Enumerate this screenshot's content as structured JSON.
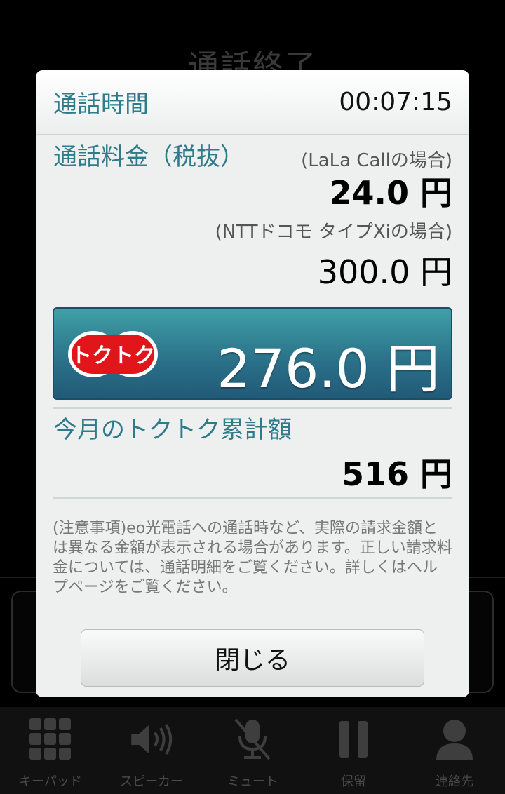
{
  "background": {
    "title": "通話終了",
    "toolbar": [
      {
        "label": "キーパッド",
        "icon": "keypad-icon"
      },
      {
        "label": "スピーカー",
        "icon": "speaker-icon"
      },
      {
        "label": "ミュート",
        "icon": "mute-icon"
      },
      {
        "label": "保留",
        "icon": "hold-icon"
      },
      {
        "label": "連絡先",
        "icon": "contacts-icon"
      }
    ]
  },
  "dialog": {
    "duration_label": "通話時間",
    "duration_value": "00:07:15",
    "fee_label": "通話料金（税抜）",
    "lalacall_note": "(LaLa Callの場合)",
    "lalacall_amount": "24.0 円",
    "docomo_note": "(NTTドコモ タイプXiの場合)",
    "docomo_amount": "300.0 円",
    "tokutoku_badge": "トクトク",
    "savings_amount": "276.0 円",
    "monthly_label": "今月のトクトク累計額",
    "monthly_amount": "516 円",
    "caution_text": "(注意事項)eo光電話への通話時など、実際の請求金額とは異なる金額が表示される場合があります。正しい請求料金については、通話明細をご覧ください。詳しくはヘルプページをご覧ください。",
    "close_label": "閉じる"
  },
  "colors": {
    "accent_text": "#2f7b8a",
    "savings_bg": "#2a6f88",
    "badge_red": "#e0161b"
  }
}
